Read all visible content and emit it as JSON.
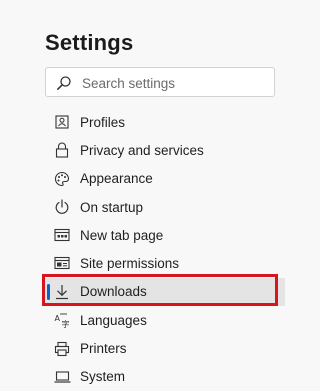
{
  "page": {
    "title": "Settings"
  },
  "search": {
    "placeholder": "Search settings",
    "value": ""
  },
  "nav": {
    "items": [
      {
        "label": "Profiles",
        "icon": "profile-card-icon"
      },
      {
        "label": "Privacy and services",
        "icon": "lock-icon"
      },
      {
        "label": "Appearance",
        "icon": "palette-icon"
      },
      {
        "label": "On startup",
        "icon": "power-icon"
      },
      {
        "label": "New tab page",
        "icon": "new-tab-icon"
      },
      {
        "label": "Site permissions",
        "icon": "site-permissions-icon"
      },
      {
        "label": "Downloads",
        "icon": "download-icon",
        "selected": true
      },
      {
        "label": "Languages",
        "icon": "languages-icon"
      },
      {
        "label": "Printers",
        "icon": "printer-icon"
      },
      {
        "label": "System",
        "icon": "laptop-icon"
      }
    ]
  },
  "colors": {
    "accent": "#0a64c4",
    "highlight_box": "#d8141c",
    "selected_bg": "#e4e4e4",
    "background": "#f8f8f8"
  }
}
